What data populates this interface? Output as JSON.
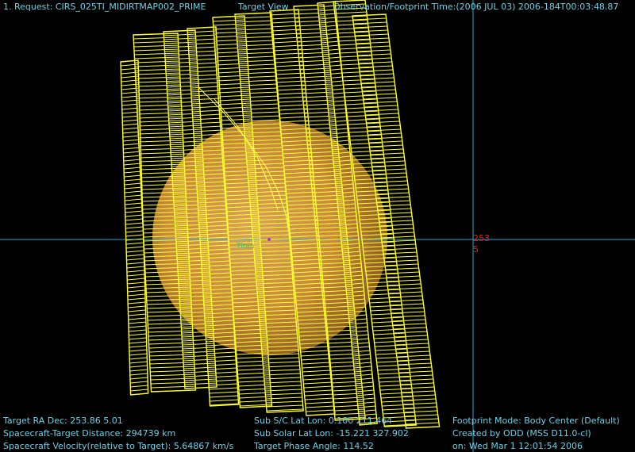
{
  "header": {
    "request": "1. Request: CIRS_025TI_MIDIRTMAP002_PRIME",
    "view": "Target View",
    "time": "Observation/Footprint Time:(2006 JUL 03) 2006-184T00:03:48.87"
  },
  "target_markers": {
    "ra": "253",
    "dec": "5",
    "sub_label": "Titan"
  },
  "info_left": {
    "line1": "Target RA  Dec: 253.86    5.01",
    "line2": "Spacecraft-Target Distance:  294739 km",
    "line3": "Spacecraft Velocity(relative to Target): 5.64867 km/s"
  },
  "info_mid": {
    "line1": "Sub S/C Lat Lon:  0.100  211.464",
    "line2": "Sub Solar Lat Lon: -15.221  327.902",
    "line3": "Target Phase Angle: 114.52"
  },
  "info_right": {
    "line1": "Footprint Mode: Body Center (Default)",
    "line2": "Created by ODD (MSS D11.0-cl)",
    "line3": "on: Wed Mar  1 12:01:54 2006"
  },
  "colors": {
    "background": "#000000",
    "crosshair": "#2aa8d0",
    "footprint": "#ffff33",
    "planet": "#c98a3a",
    "text": "#6fd0e6",
    "marker": "#e02020"
  }
}
